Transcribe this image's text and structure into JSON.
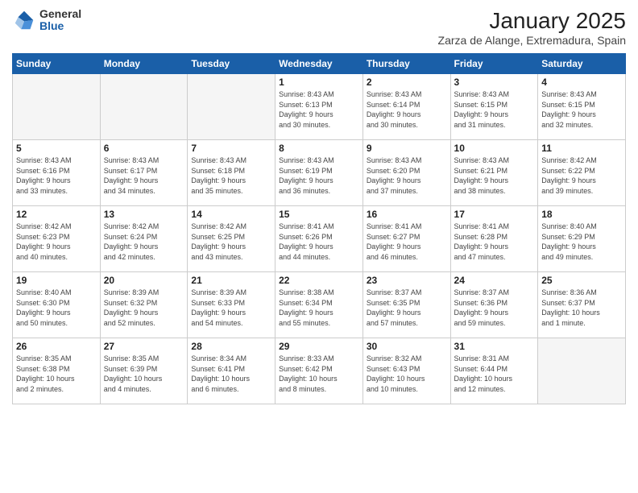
{
  "logo": {
    "general": "General",
    "blue": "Blue"
  },
  "header": {
    "month": "January 2025",
    "location": "Zarza de Alange, Extremadura, Spain"
  },
  "weekdays": [
    "Sunday",
    "Monday",
    "Tuesday",
    "Wednesday",
    "Thursday",
    "Friday",
    "Saturday"
  ],
  "weeks": [
    [
      {
        "day": "",
        "info": ""
      },
      {
        "day": "",
        "info": ""
      },
      {
        "day": "",
        "info": ""
      },
      {
        "day": "1",
        "info": "Sunrise: 8:43 AM\nSunset: 6:13 PM\nDaylight: 9 hours\nand 30 minutes."
      },
      {
        "day": "2",
        "info": "Sunrise: 8:43 AM\nSunset: 6:14 PM\nDaylight: 9 hours\nand 30 minutes."
      },
      {
        "day": "3",
        "info": "Sunrise: 8:43 AM\nSunset: 6:15 PM\nDaylight: 9 hours\nand 31 minutes."
      },
      {
        "day": "4",
        "info": "Sunrise: 8:43 AM\nSunset: 6:15 PM\nDaylight: 9 hours\nand 32 minutes."
      }
    ],
    [
      {
        "day": "5",
        "info": "Sunrise: 8:43 AM\nSunset: 6:16 PM\nDaylight: 9 hours\nand 33 minutes."
      },
      {
        "day": "6",
        "info": "Sunrise: 8:43 AM\nSunset: 6:17 PM\nDaylight: 9 hours\nand 34 minutes."
      },
      {
        "day": "7",
        "info": "Sunrise: 8:43 AM\nSunset: 6:18 PM\nDaylight: 9 hours\nand 35 minutes."
      },
      {
        "day": "8",
        "info": "Sunrise: 8:43 AM\nSunset: 6:19 PM\nDaylight: 9 hours\nand 36 minutes."
      },
      {
        "day": "9",
        "info": "Sunrise: 8:43 AM\nSunset: 6:20 PM\nDaylight: 9 hours\nand 37 minutes."
      },
      {
        "day": "10",
        "info": "Sunrise: 8:43 AM\nSunset: 6:21 PM\nDaylight: 9 hours\nand 38 minutes."
      },
      {
        "day": "11",
        "info": "Sunrise: 8:42 AM\nSunset: 6:22 PM\nDaylight: 9 hours\nand 39 minutes."
      }
    ],
    [
      {
        "day": "12",
        "info": "Sunrise: 8:42 AM\nSunset: 6:23 PM\nDaylight: 9 hours\nand 40 minutes."
      },
      {
        "day": "13",
        "info": "Sunrise: 8:42 AM\nSunset: 6:24 PM\nDaylight: 9 hours\nand 42 minutes."
      },
      {
        "day": "14",
        "info": "Sunrise: 8:42 AM\nSunset: 6:25 PM\nDaylight: 9 hours\nand 43 minutes."
      },
      {
        "day": "15",
        "info": "Sunrise: 8:41 AM\nSunset: 6:26 PM\nDaylight: 9 hours\nand 44 minutes."
      },
      {
        "day": "16",
        "info": "Sunrise: 8:41 AM\nSunset: 6:27 PM\nDaylight: 9 hours\nand 46 minutes."
      },
      {
        "day": "17",
        "info": "Sunrise: 8:41 AM\nSunset: 6:28 PM\nDaylight: 9 hours\nand 47 minutes."
      },
      {
        "day": "18",
        "info": "Sunrise: 8:40 AM\nSunset: 6:29 PM\nDaylight: 9 hours\nand 49 minutes."
      }
    ],
    [
      {
        "day": "19",
        "info": "Sunrise: 8:40 AM\nSunset: 6:30 PM\nDaylight: 9 hours\nand 50 minutes."
      },
      {
        "day": "20",
        "info": "Sunrise: 8:39 AM\nSunset: 6:32 PM\nDaylight: 9 hours\nand 52 minutes."
      },
      {
        "day": "21",
        "info": "Sunrise: 8:39 AM\nSunset: 6:33 PM\nDaylight: 9 hours\nand 54 minutes."
      },
      {
        "day": "22",
        "info": "Sunrise: 8:38 AM\nSunset: 6:34 PM\nDaylight: 9 hours\nand 55 minutes."
      },
      {
        "day": "23",
        "info": "Sunrise: 8:37 AM\nSunset: 6:35 PM\nDaylight: 9 hours\nand 57 minutes."
      },
      {
        "day": "24",
        "info": "Sunrise: 8:37 AM\nSunset: 6:36 PM\nDaylight: 9 hours\nand 59 minutes."
      },
      {
        "day": "25",
        "info": "Sunrise: 8:36 AM\nSunset: 6:37 PM\nDaylight: 10 hours\nand 1 minute."
      }
    ],
    [
      {
        "day": "26",
        "info": "Sunrise: 8:35 AM\nSunset: 6:38 PM\nDaylight: 10 hours\nand 2 minutes."
      },
      {
        "day": "27",
        "info": "Sunrise: 8:35 AM\nSunset: 6:39 PM\nDaylight: 10 hours\nand 4 minutes."
      },
      {
        "day": "28",
        "info": "Sunrise: 8:34 AM\nSunset: 6:41 PM\nDaylight: 10 hours\nand 6 minutes."
      },
      {
        "day": "29",
        "info": "Sunrise: 8:33 AM\nSunset: 6:42 PM\nDaylight: 10 hours\nand 8 minutes."
      },
      {
        "day": "30",
        "info": "Sunrise: 8:32 AM\nSunset: 6:43 PM\nDaylight: 10 hours\nand 10 minutes."
      },
      {
        "day": "31",
        "info": "Sunrise: 8:31 AM\nSunset: 6:44 PM\nDaylight: 10 hours\nand 12 minutes."
      },
      {
        "day": "",
        "info": ""
      }
    ]
  ]
}
